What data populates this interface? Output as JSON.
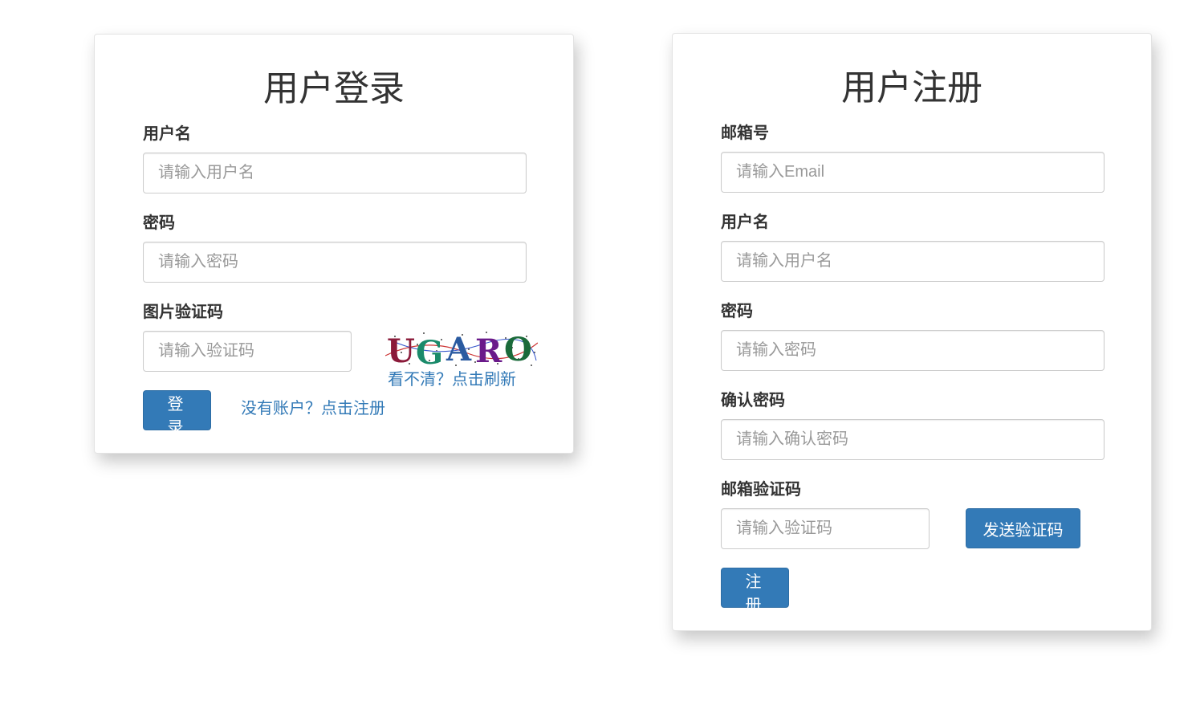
{
  "login": {
    "title": "用户登录",
    "username_label": "用户名",
    "username_placeholder": "请输入用户名",
    "password_label": "密码",
    "password_placeholder": "请输入密码",
    "captcha_label": "图片验证码",
    "captcha_placeholder": "请输入验证码",
    "captcha_text": "UGARO",
    "refresh_link": "看不清？点击刷新",
    "login_button": "登 录",
    "register_link": "没有账户？点击注册"
  },
  "register": {
    "title": "用户注册",
    "email_label": "邮箱号",
    "email_placeholder": "请输入Email",
    "username_label": "用户名",
    "username_placeholder": "请输入用户名",
    "password_label": "密码",
    "password_placeholder": "请输入密码",
    "confirm_label": "确认密码",
    "confirm_placeholder": "请输入确认密码",
    "code_label": "邮箱验证码",
    "code_placeholder": "请输入验证码",
    "send_code_button": "发送验证码",
    "register_button": "注 册"
  },
  "colors": {
    "primary": "#337ab7",
    "text": "#333333",
    "placeholder": "#999999",
    "border": "#cccccc"
  }
}
